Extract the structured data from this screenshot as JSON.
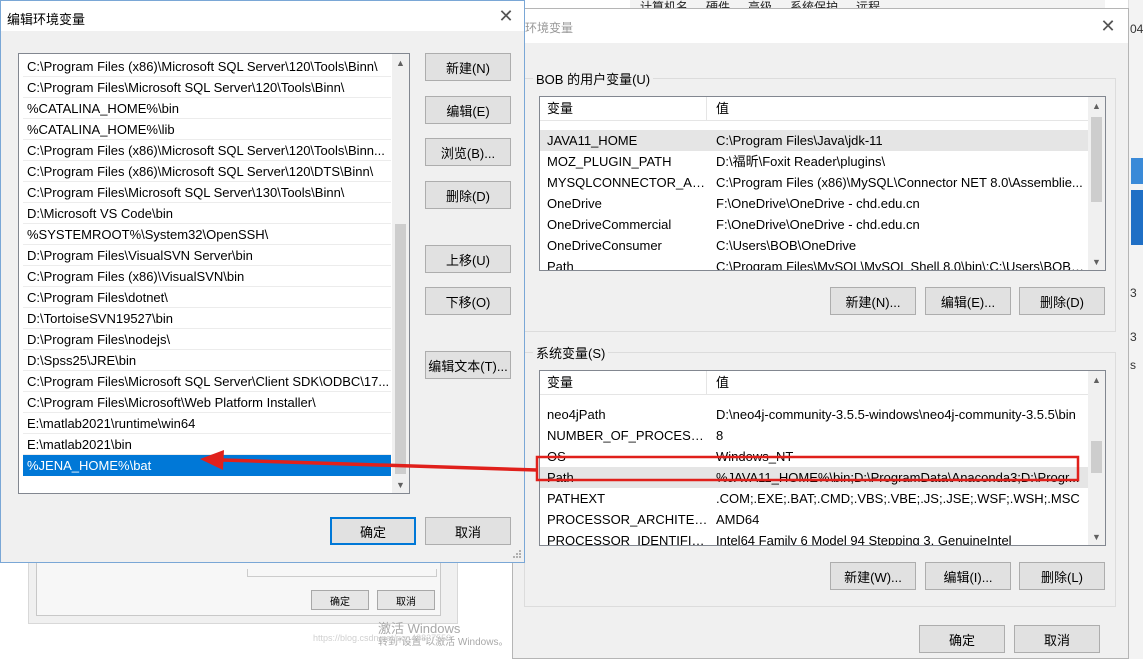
{
  "background": {
    "taskbar_tabs": [
      "计算机名",
      "硬件",
      "高级",
      "系统保护",
      "远程"
    ],
    "right_edge_texts": [
      "04",
      "3",
      "3",
      "s"
    ],
    "sysprops_buttons": [
      "确定",
      "取消"
    ]
  },
  "edit_dialog": {
    "title": "编辑环境变量",
    "close_glyph": "✕",
    "items": [
      "C:\\Program Files (x86)\\Microsoft SQL Server\\120\\Tools\\Binn\\",
      "C:\\Program Files\\Microsoft SQL Server\\120\\Tools\\Binn\\",
      "%CATALINA_HOME%\\bin",
      "%CATALINA_HOME%\\lib",
      "C:\\Program Files (x86)\\Microsoft SQL Server\\120\\Tools\\Binn...",
      "C:\\Program Files (x86)\\Microsoft SQL Server\\120\\DTS\\Binn\\",
      "C:\\Program Files\\Microsoft SQL Server\\130\\Tools\\Binn\\",
      "D:\\Microsoft VS Code\\bin",
      "%SYSTEMROOT%\\System32\\OpenSSH\\",
      "D:\\Program Files\\VisualSVN Server\\bin",
      "C:\\Program Files (x86)\\VisualSVN\\bin",
      "C:\\Program Files\\dotnet\\",
      "D:\\TortoiseSVN19527\\bin",
      "D:\\Program Files\\nodejs\\",
      "D:\\Spss25\\JRE\\bin",
      "C:\\Program Files\\Microsoft SQL Server\\Client SDK\\ODBC\\17...",
      "C:\\Program Files\\Microsoft\\Web Platform Installer\\",
      "E:\\matlab2021\\runtime\\win64",
      "E:\\matlab2021\\bin",
      "%JENA_HOME%\\bat"
    ],
    "selected_index": 19,
    "buttons": {
      "new": "新建(N)",
      "edit": "编辑(E)",
      "browse": "浏览(B)...",
      "delete": "删除(D)",
      "move_up": "上移(U)",
      "move_down": "下移(O)",
      "edit_text": "编辑文本(T)...",
      "ok": "确定",
      "cancel": "取消"
    }
  },
  "env_dialog": {
    "title": "环境变量",
    "close_glyph": "✕",
    "user_group_label": "BOB 的用户变量(U)",
    "system_group_label": "系统变量(S)",
    "col_variable": "变量",
    "col_value": "值",
    "user_vars": [
      {
        "name": "JAVA11_HOME",
        "value": "C:\\Program Files\\Java\\jdk-11"
      },
      {
        "name": "MOZ_PLUGIN_PATH",
        "value": "D:\\福昕\\Foxit Reader\\plugins\\"
      },
      {
        "name": "MYSQLCONNECTOR_ASS...",
        "value": "C:\\Program Files (x86)\\MySQL\\Connector NET 8.0\\Assemblie..."
      },
      {
        "name": "OneDrive",
        "value": "F:\\OneDrive\\OneDrive - chd.edu.cn"
      },
      {
        "name": "OneDriveCommercial",
        "value": "F:\\OneDrive\\OneDrive - chd.edu.cn"
      },
      {
        "name": "OneDriveConsumer",
        "value": "C:\\Users\\BOB\\OneDrive"
      },
      {
        "name": "Path",
        "value": "C:\\Program Files\\MySQL\\MySQL Shell 8.0\\bin\\;C:\\Users\\BOB\\..."
      }
    ],
    "user_selected_index": 0,
    "user_buttons": {
      "new": "新建(N)...",
      "edit": "编辑(E)...",
      "delete": "删除(D)"
    },
    "system_vars": [
      {
        "name": "neo4jPath",
        "value": "D:\\neo4j-community-3.5.5-windows\\neo4j-community-3.5.5\\bin"
      },
      {
        "name": "NUMBER_OF_PROCESSORS",
        "value": "8"
      },
      {
        "name": "OS",
        "value": "Windows_NT"
      },
      {
        "name": "Path",
        "value": "%JAVA11_HOME%\\bin;D:\\ProgramData\\Anaconda3;D:\\Progr..."
      },
      {
        "name": "PATHEXT",
        "value": ".COM;.EXE;.BAT;.CMD;.VBS;.VBE;.JS;.JSE;.WSF;.WSH;.MSC"
      },
      {
        "name": "PROCESSOR_ARCHITECT",
        "value": "AMD64"
      },
      {
        "name": "PROCESSOR_IDENTIFIER",
        "value": "Intel64 Family 6 Model 94 Stepping 3, GenuineIntel"
      }
    ],
    "system_selected_index": 3,
    "system_buttons": {
      "new": "新建(W)...",
      "edit": "编辑(I)...",
      "delete": "删除(L)"
    },
    "ok": "确定",
    "cancel": "取消"
  },
  "annotation": {
    "color": "#e0201b"
  },
  "watermark": {
    "line1": "激活 Windows",
    "line2": "转到\"设置\"以激活 Windows。",
    "csdn": "https://blog.csdn.net/qq_43827550"
  }
}
